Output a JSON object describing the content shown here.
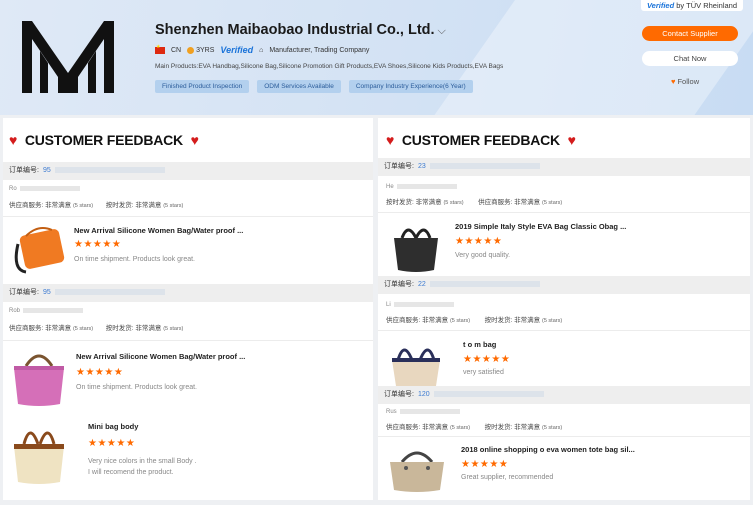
{
  "header": {
    "company_name": "Shenzhen Maibaobao Industrial Co., Ltd.",
    "country": "CN",
    "years": "3YRS",
    "verified": "Verified",
    "business_type": "Manufacturer, Trading Company",
    "main_products": "Main Products:EVA Handbag,Silicone Bag,Silicone Promotion Gift Products,EVA Shoes,Silicone Kids Products,EVA Bags",
    "tags": [
      "Finished Product Inspection",
      "ODM Services Available",
      "Company Industry Experience(6 Year)"
    ],
    "tuv_prefix": "Verified",
    "tuv_suffix": "by TÜV Rheinland",
    "contact_label": "Contact Supplier",
    "chat_label": "Chat Now",
    "follow_label": "Follow"
  },
  "left": {
    "title": "CUSTOMER FEEDBACK",
    "order_label": "订单编号:",
    "order1_num": "95",
    "order2_num": "95",
    "buyer1": "Ro",
    "buyer2": "Rob",
    "supplier_service": "供应商服务: 非常满意",
    "on_time": "按时发货: 非常满意",
    "five_stars": "(5 stars)",
    "stars": "★★★★★",
    "items": [
      {
        "title": "New Arrival Silicone Women Bag/Water proof ...",
        "comment": "On time shipment. Products look great."
      },
      {
        "title": "New Arrival Silicone Women Bag/Water proof ...",
        "comment": "On time shipment. Products look great."
      },
      {
        "title": "Mini bag body",
        "comment": "Very nice colors in the small Body .",
        "comment2": "I will recomend the product."
      }
    ]
  },
  "right": {
    "title": "CUSTOMER FEEDBACK",
    "order_label": "订单编号:",
    "order1_num": "23",
    "order2_num": "22",
    "order3_num": "120",
    "buyer1": "He",
    "buyer2": "Li",
    "buyer3": "Rus",
    "on_time": "按时发货: 非常满意",
    "supplier_service": "供应商服务: 非常满意",
    "five_stars": "(5 stars)",
    "stars": "★★★★★",
    "items": [
      {
        "title": "2019 Simple Italy Style EVA Bag Classic Obag ...",
        "comment": "Very good quality."
      },
      {
        "title": "t o m bag",
        "comment": "very satisfied"
      },
      {
        "title": "2018 online shopping o eva women tote bag sil...",
        "comment": "Great supplier, recommended"
      }
    ]
  }
}
